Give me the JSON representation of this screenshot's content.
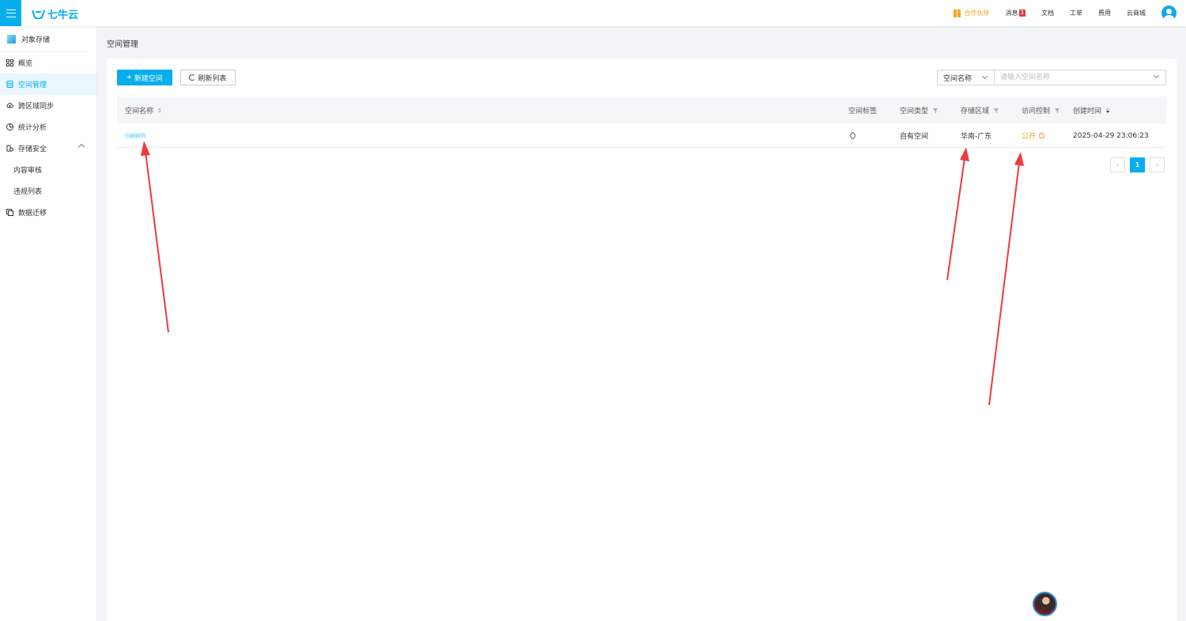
{
  "topbar": {
    "logo_text": "七牛云",
    "nav": {
      "partner": "合作伙伴",
      "messages": "消息",
      "messages_badge": "3",
      "docs": "文档",
      "tickets": "工单",
      "billing": "费用",
      "marketplace": "云商城"
    }
  },
  "sidebar": {
    "product": "对象存储",
    "items": [
      {
        "label": "概览",
        "icon": "grid-icon"
      },
      {
        "label": "空间管理",
        "icon": "bucket-icon",
        "active": true
      },
      {
        "label": "跨区域同步",
        "icon": "cloud-sync-icon"
      },
      {
        "label": "统计分析",
        "icon": "chart-icon"
      },
      {
        "label": "存储安全",
        "icon": "security-icon",
        "expanded": true
      },
      {
        "label": "内容审核",
        "sub": true
      },
      {
        "label": "违规列表",
        "sub": true
      },
      {
        "label": "数据迁移",
        "icon": "migrate-icon"
      }
    ]
  },
  "page": {
    "title": "空间管理"
  },
  "toolbar": {
    "create_label": "新建空间",
    "refresh_label": "刷新列表",
    "search_field_select": "空间名称",
    "search_placeholder": "请输入空间名称"
  },
  "table": {
    "headers": {
      "name": "空间名称",
      "tags": "空间标签",
      "type": "空间类型",
      "region": "存储区域",
      "access": "访问控制",
      "created": "创建时间"
    },
    "rows": [
      {
        "name": "caixin",
        "type": "自有空间",
        "region": "华南-广东",
        "access": "公开",
        "created": "2025-04-29 23:06:23"
      }
    ]
  },
  "pagination": {
    "current": "1",
    "prev": "‹",
    "next": "›"
  },
  "colors": {
    "brand": "#06aeec",
    "warning": "#f29b1b",
    "annotation_arrow": "#f0393c"
  }
}
